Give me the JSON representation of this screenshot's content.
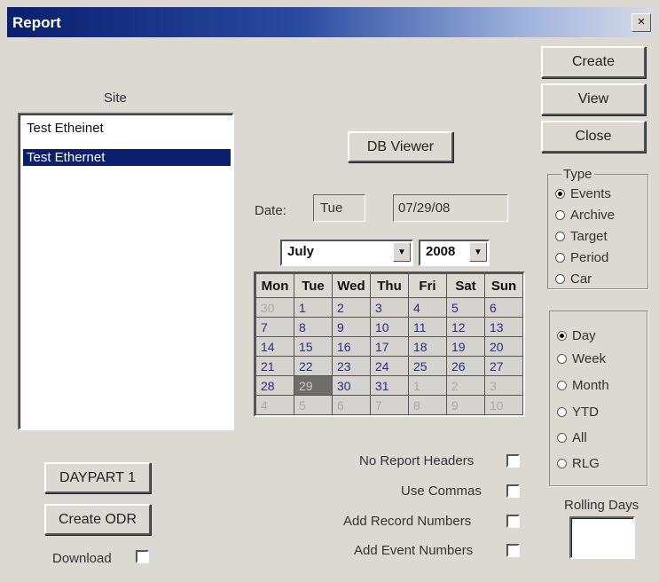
{
  "window": {
    "title": "Report",
    "close_glyph": "×"
  },
  "site": {
    "label": "Site",
    "input_value": "Test Etheinet",
    "items": [
      "Test Ethernet"
    ]
  },
  "buttons": {
    "db_viewer": "DB Viewer",
    "create": "Create",
    "view": "View",
    "close": "Close",
    "daypart": "DAYPART 1",
    "create_odr": "Create ODR"
  },
  "date": {
    "label": "Date:",
    "day": "Tue",
    "value": "07/29/08",
    "month": "July",
    "year": "2008"
  },
  "calendar": {
    "headers": [
      "Mon",
      "Tue",
      "Wed",
      "Thu",
      "Fri",
      "Sat",
      "Sun"
    ],
    "weeks": [
      [
        "30",
        "1",
        "2",
        "3",
        "4",
        "5",
        "6"
      ],
      [
        "7",
        "8",
        "9",
        "10",
        "11",
        "12",
        "13"
      ],
      [
        "14",
        "15",
        "16",
        "17",
        "18",
        "19",
        "20"
      ],
      [
        "21",
        "22",
        "23",
        "24",
        "25",
        "26",
        "27"
      ],
      [
        "28",
        "29",
        "30",
        "31",
        "1",
        "2",
        "3"
      ],
      [
        "4",
        "5",
        "6",
        "7",
        "8",
        "9",
        "10"
      ]
    ]
  },
  "type_group": {
    "label": "Type",
    "options": [
      "Events",
      "Archive",
      "Target",
      "Period",
      "Car"
    ],
    "selected": "Events"
  },
  "period_group": {
    "options": [
      "Day",
      "Week",
      "Month",
      "YTD",
      "All",
      "RLG"
    ],
    "selected": "Day"
  },
  "options": {
    "no_report_headers": "No Report Headers",
    "use_commas": "Use Commas",
    "add_record_numbers": "Add Record Numbers",
    "add_event_numbers": "Add Event Numbers",
    "download": "Download"
  },
  "rolling_days": {
    "label": "Rolling Days",
    "value": ""
  }
}
